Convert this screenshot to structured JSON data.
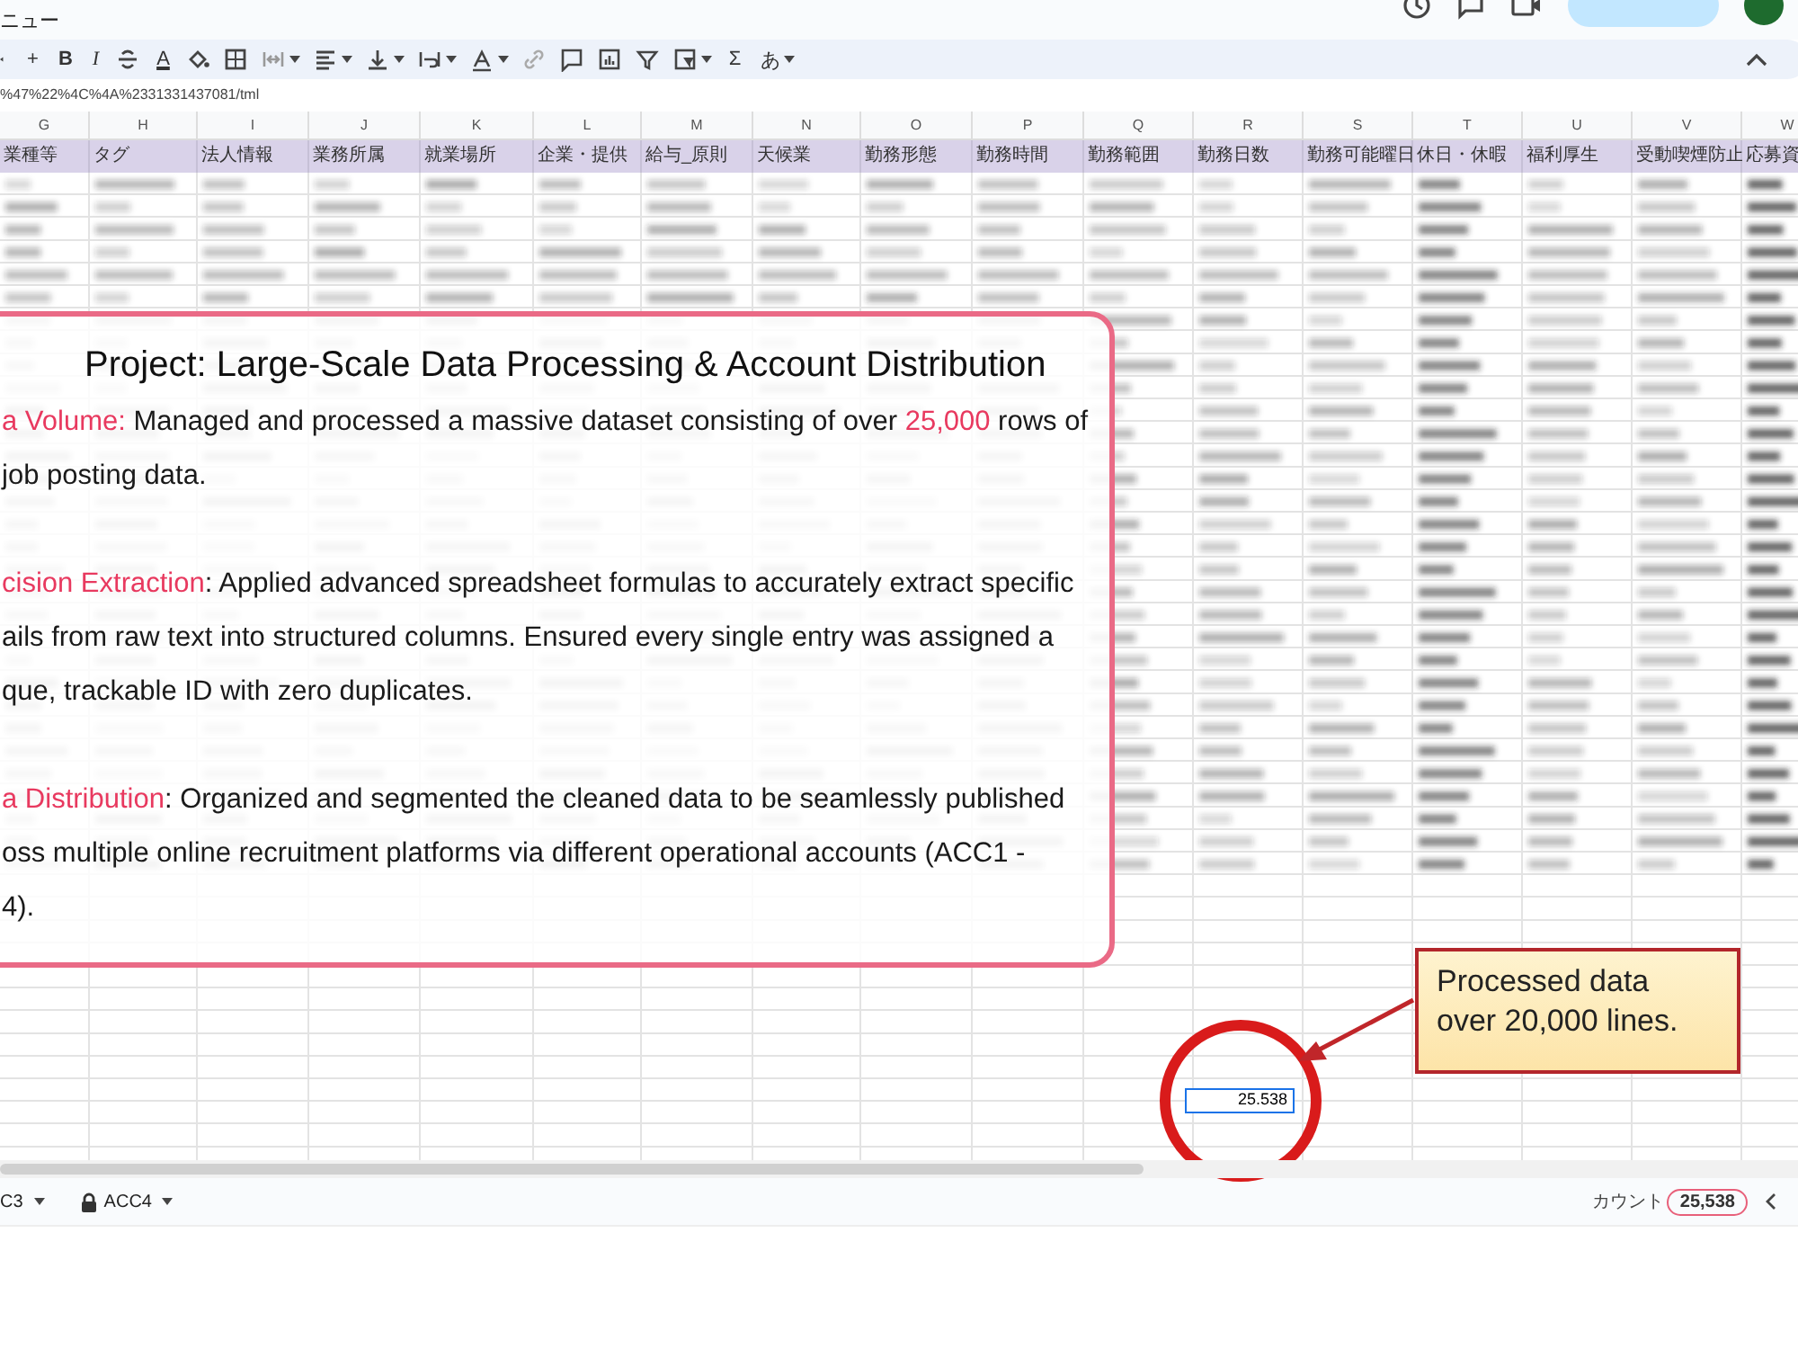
{
  "menu": {
    "label": "ニュー"
  },
  "toolbar": [
    {
      "kind": "caret"
    },
    {
      "kind": "text",
      "text": "+"
    },
    {
      "kind": "bold",
      "text": "B"
    },
    {
      "kind": "italic",
      "text": "I"
    },
    {
      "kind": "strike"
    },
    {
      "kind": "textcolor",
      "text": "A"
    },
    {
      "kind": "fill"
    },
    {
      "kind": "borders"
    },
    {
      "kind": "merge",
      "dropdown": true
    },
    {
      "kind": "halign",
      "dropdown": true
    },
    {
      "kind": "valign",
      "dropdown": true
    },
    {
      "kind": "wrap",
      "dropdown": true
    },
    {
      "kind": "rotate",
      "dropdown": true
    },
    {
      "kind": "link"
    },
    {
      "kind": "comment"
    },
    {
      "kind": "chart"
    },
    {
      "kind": "filter"
    },
    {
      "kind": "view",
      "dropdown": true
    },
    {
      "kind": "text",
      "text": "Σ"
    },
    {
      "kind": "font",
      "text": "あ",
      "dropdown": true
    }
  ],
  "formula_bar": {
    "value": "%47%22%4C%4A%2331331437081/tml"
  },
  "columns": [
    {
      "letter": "G",
      "header": "業種等"
    },
    {
      "letter": "H",
      "header": "タグ"
    },
    {
      "letter": "I",
      "header": "法人情報"
    },
    {
      "letter": "J",
      "header": "業務所属"
    },
    {
      "letter": "K",
      "header": "就業場所"
    },
    {
      "letter": "L",
      "header": "企業・提供"
    },
    {
      "letter": "M",
      "header": "給与_原則"
    },
    {
      "letter": "N",
      "header": "天候業"
    },
    {
      "letter": "O",
      "header": "勤務形態"
    },
    {
      "letter": "P",
      "header": "勤務時間"
    },
    {
      "letter": "Q",
      "header": "勤務範囲"
    },
    {
      "letter": "R",
      "header": "勤務日数"
    },
    {
      "letter": "S",
      "header": "勤務可能曜日"
    },
    {
      "letter": "T",
      "header": "休日・休暇"
    },
    {
      "letter": "U",
      "header": "福利厚生"
    },
    {
      "letter": "V",
      "header": "受動喫煙防止"
    },
    {
      "letter": "W",
      "header": "応募資"
    }
  ],
  "selected_cell": {
    "value": "25.538"
  },
  "overlay": {
    "title": "Project: Large-Scale Data Processing & Account Distribution",
    "paragraphs": [
      [
        [
          {
            "text": "a Volume:",
            "highlight": true
          },
          {
            "text": " Managed and processed a massive dataset consisting of over ",
            "highlight": false
          },
          {
            "text": "25,000",
            "highlight": true
          },
          {
            "text": " rows of",
            "highlight": false
          }
        ],
        [
          {
            "text": " job posting data.",
            "highlight": false
          }
        ]
      ],
      [
        [
          {
            "text": "cision Extraction",
            "highlight": true
          },
          {
            "text": ": Applied advanced spreadsheet formulas to accurately extract specific",
            "highlight": false
          }
        ],
        [
          {
            "text": "ails from raw text into structured columns. Ensured every single entry was assigned a",
            "highlight": false
          }
        ],
        [
          {
            "text": "que, trackable ID with zero duplicates.",
            "highlight": false
          }
        ]
      ],
      [
        [
          {
            "text": "a Distribution",
            "highlight": true
          },
          {
            "text": ": Organized and segmented the cleaned data to be seamlessly published",
            "highlight": false
          }
        ],
        [
          {
            "text": "oss multiple online recruitment platforms via different operational accounts (ACC1 -",
            "highlight": false
          }
        ],
        [
          {
            "text": "4).",
            "highlight": false
          }
        ]
      ]
    ]
  },
  "callout": {
    "text": "Processed data over 20,000 lines."
  },
  "sheet_tabs": [
    {
      "label": "C3",
      "locked": false,
      "selected": false
    },
    {
      "label": "ACC4",
      "locked": true,
      "selected": false
    }
  ],
  "status": {
    "label": "カウント",
    "value": "25,538"
  }
}
